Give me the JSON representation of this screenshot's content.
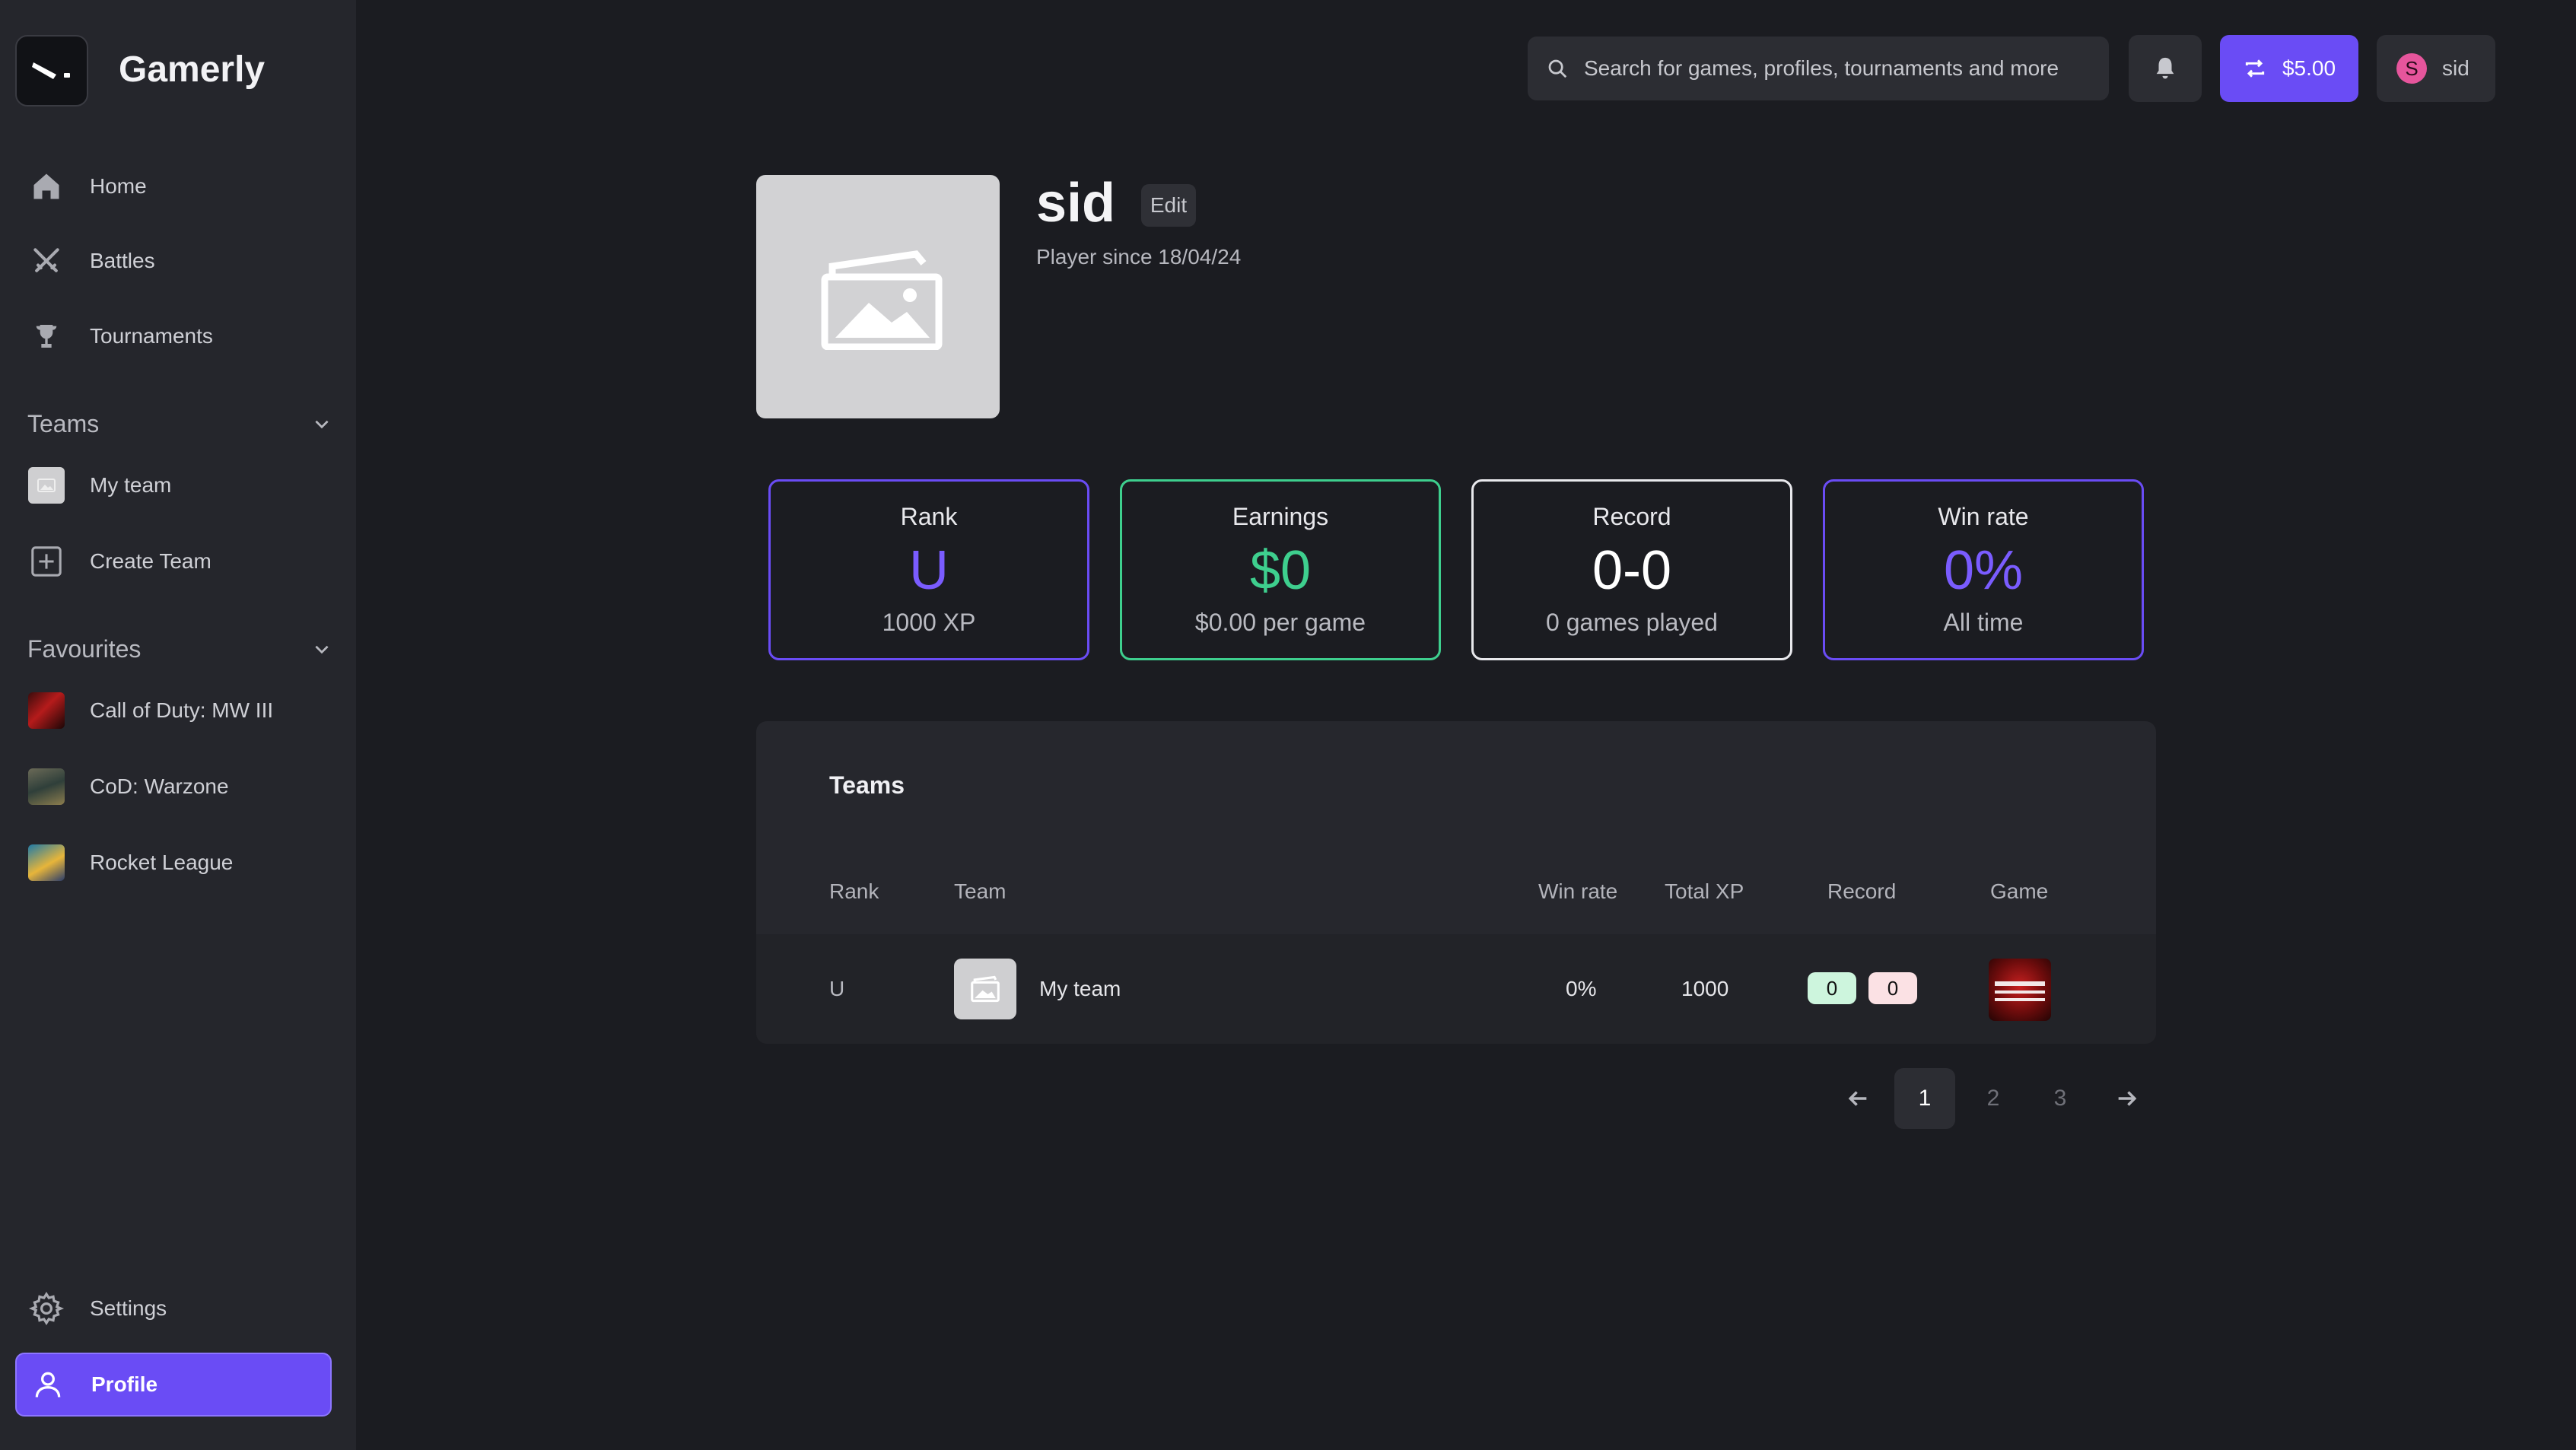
{
  "app": {
    "brand": "Gamerly"
  },
  "sidebar": {
    "nav": [
      {
        "label": "Home",
        "icon": "home-icon"
      },
      {
        "label": "Battles",
        "icon": "crossed-swords-icon"
      },
      {
        "label": "Tournaments",
        "icon": "trophy-icon"
      }
    ],
    "teams_section": {
      "label": "Teams",
      "items": [
        {
          "label": "My team",
          "icon": "image-placeholder-icon"
        },
        {
          "label": "Create Team",
          "icon": "plus-square-icon"
        }
      ]
    },
    "favourites_section": {
      "label": "Favourites",
      "items": [
        {
          "label": "Call of Duty: MW III"
        },
        {
          "label": "CoD: Warzone"
        },
        {
          "label": "Rocket League"
        }
      ]
    },
    "settings_label": "Settings",
    "profile_label": "Profile"
  },
  "topbar": {
    "search_placeholder": "Search for games, profiles, tournaments and more",
    "wallet_amount": "$5.00",
    "user_initial": "S",
    "user_name": "sid"
  },
  "profile": {
    "name": "sid",
    "edit_label": "Edit",
    "player_since": "Player since 18/04/24"
  },
  "stats": [
    {
      "title": "Rank",
      "value": "U",
      "sub": "1000 XP",
      "color": "#6a4cf5",
      "value_color": "#7a5cff"
    },
    {
      "title": "Earnings",
      "value": "$0",
      "sub": "$0.00 per game",
      "color": "#3ecf8e",
      "value_color": "#3ecf8e"
    },
    {
      "title": "Record",
      "value": "0-0",
      "sub": "0 games played",
      "color": "#e8e8ec",
      "value_color": "#ffffff"
    },
    {
      "title": "Win rate",
      "value": "0%",
      "sub": "All time",
      "color": "#6a4cf5",
      "value_color": "#7a5cff"
    }
  ],
  "teams_table": {
    "title": "Teams",
    "columns": [
      "Rank",
      "Team",
      "Win rate",
      "Total XP",
      "Record",
      "Game"
    ],
    "rows": [
      {
        "rank": "U",
        "team": "My team",
        "win_rate": "0%",
        "total_xp": "1000",
        "wins": "0",
        "losses": "0"
      }
    ]
  },
  "pagination": {
    "pages": [
      "1",
      "2",
      "3"
    ],
    "current": "1"
  },
  "colors": {
    "accent": "#6a4cf5",
    "win_pill": "#cdf5dd",
    "loss_pill": "#fbe1e4"
  }
}
